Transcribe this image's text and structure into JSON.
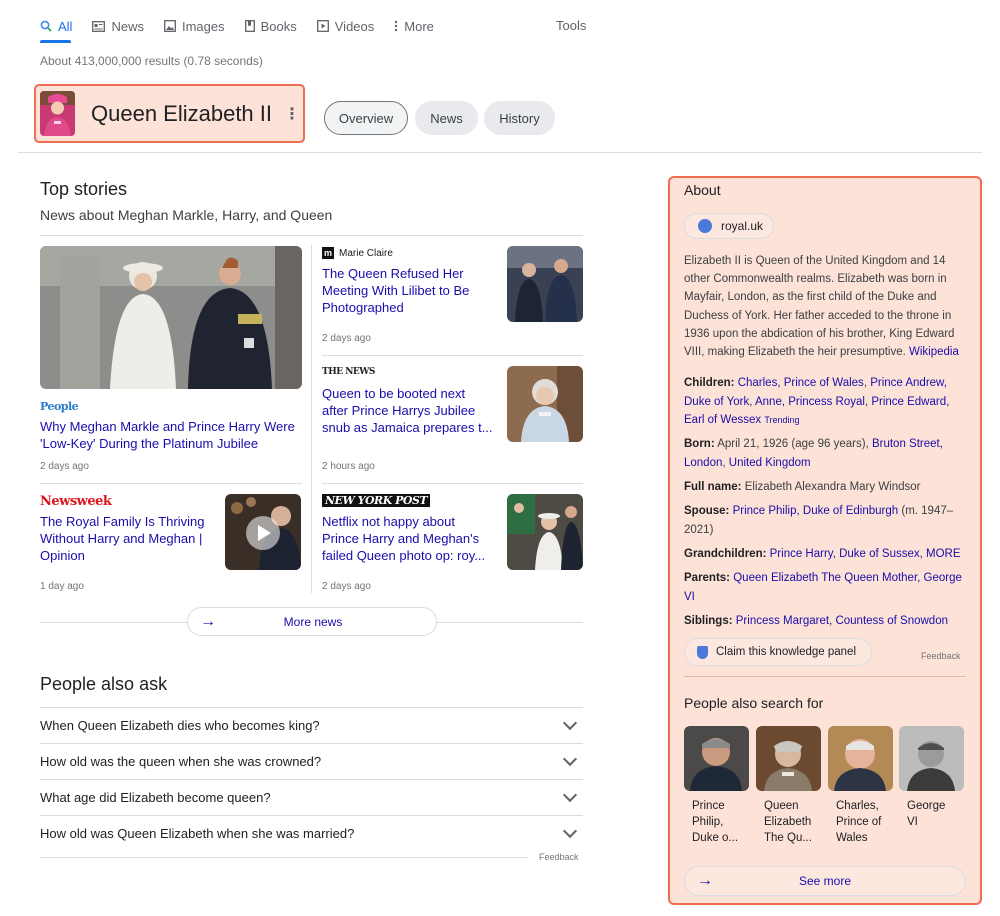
{
  "tabs": [
    {
      "label": "All",
      "icon": "search-icon",
      "active": true
    },
    {
      "label": "News",
      "icon": "newspaper-icon"
    },
    {
      "label": "Images",
      "icon": "image-icon"
    },
    {
      "label": "Books",
      "icon": "book-icon"
    },
    {
      "label": "Videos",
      "icon": "play-icon"
    },
    {
      "label": "More",
      "icon": "more-vert-icon"
    }
  ],
  "tools_label": "Tools",
  "results_stats": "About 413,000,000 results (0.78 seconds)",
  "entity": {
    "title": "Queen Elizabeth II",
    "pills": [
      "Overview",
      "News",
      "History"
    ]
  },
  "top_stories": {
    "heading": "Top stories",
    "subheading": "News about Meghan Markle, Harry, and Queen",
    "cards": [
      {
        "source": "People",
        "headline_lines": [
          "Why Meghan Markle and Prince Harry Were",
          "'Low-Key' During the Platinum Jubilee"
        ],
        "age": "2 days ago"
      },
      {
        "source": "Marie Claire",
        "headline_lines": [
          "The Queen Refused Her",
          "Meeting With Lilibet to Be",
          "Photographed"
        ],
        "age": "2 days ago"
      },
      {
        "source": "THE NEWS",
        "headline_lines": [
          "Queen to be booted next",
          "after Prince Harrys Jubilee",
          "snub as Jamaica prepares t..."
        ],
        "age": "2 hours ago"
      },
      {
        "source": "Newsweek",
        "headline_lines": [
          "The Royal Family Is Thriving",
          "Without Harry and Meghan |",
          "Opinion"
        ],
        "age": "1 day ago"
      },
      {
        "source": "NEW YORK POST",
        "headline_lines": [
          "Netflix not happy about",
          "Prince Harry and Meghan's",
          "failed Queen photo op: roy..."
        ],
        "age": "2 days ago"
      }
    ],
    "more_news": "More news"
  },
  "paa": {
    "heading": "People also ask",
    "questions": [
      "When Queen Elizabeth dies who becomes king?",
      "How old was the queen when she was crowned?",
      "What age did Elizabeth become queen?",
      "How old was Queen Elizabeth when she was married?"
    ],
    "feedback": "Feedback"
  },
  "knowledge_panel": {
    "about": "About",
    "site_chip": "royal.uk",
    "description": "Elizabeth II is Queen of the United Kingdom and 14 other Commonwealth realms. Elizabeth was born in Mayfair, London, as the first child of the Duke and Duchess of York. Her father acceded to the throne in 1936 upon the abdication of his brother, King Edward VIII, making Elizabeth the heir presumptive.",
    "wiki_link": "Wikipedia",
    "children_label": "Children:",
    "children": [
      "Charles, Prince of Wales",
      "Prince Andrew, Duke of York",
      "Anne, Princess Royal",
      "Prince Edward, Earl of Wessex"
    ],
    "trending": "Trending",
    "born_label": "Born:",
    "born_text": "April 21, 1926 (age 96 years),",
    "born_place": [
      "Bruton Street, London",
      "United Kingdom"
    ],
    "fullname_label": "Full name:",
    "fullname": "Elizabeth Alexandra Mary Windsor",
    "spouse_label": "Spouse:",
    "spouse": "Prince Philip, Duke of Edinburgh",
    "spouse_years": "(m. 1947–2021)",
    "grandchildren_label": "Grandchildren:",
    "grandchildren": "Prince Harry, Duke of Sussex,",
    "grandchildren_more": "MORE",
    "parents_label": "Parents:",
    "parents": "Queen Elizabeth The Queen Mother,",
    "parents2": "George VI",
    "siblings_label": "Siblings:",
    "siblings": "Princess Margaret, Countess of Snowdon",
    "claim": "Claim this knowledge panel",
    "feedback": "Feedback",
    "pas_heading": "People also search for",
    "pas": [
      {
        "lines": [
          "Prince",
          "Philip,",
          "Duke o..."
        ]
      },
      {
        "lines": [
          "Queen",
          "Elizabeth",
          "The Qu..."
        ]
      },
      {
        "lines": [
          "Charles,",
          "Prince of",
          "Wales"
        ]
      },
      {
        "lines": [
          "George",
          "VI"
        ]
      }
    ],
    "see_more": "See more"
  }
}
